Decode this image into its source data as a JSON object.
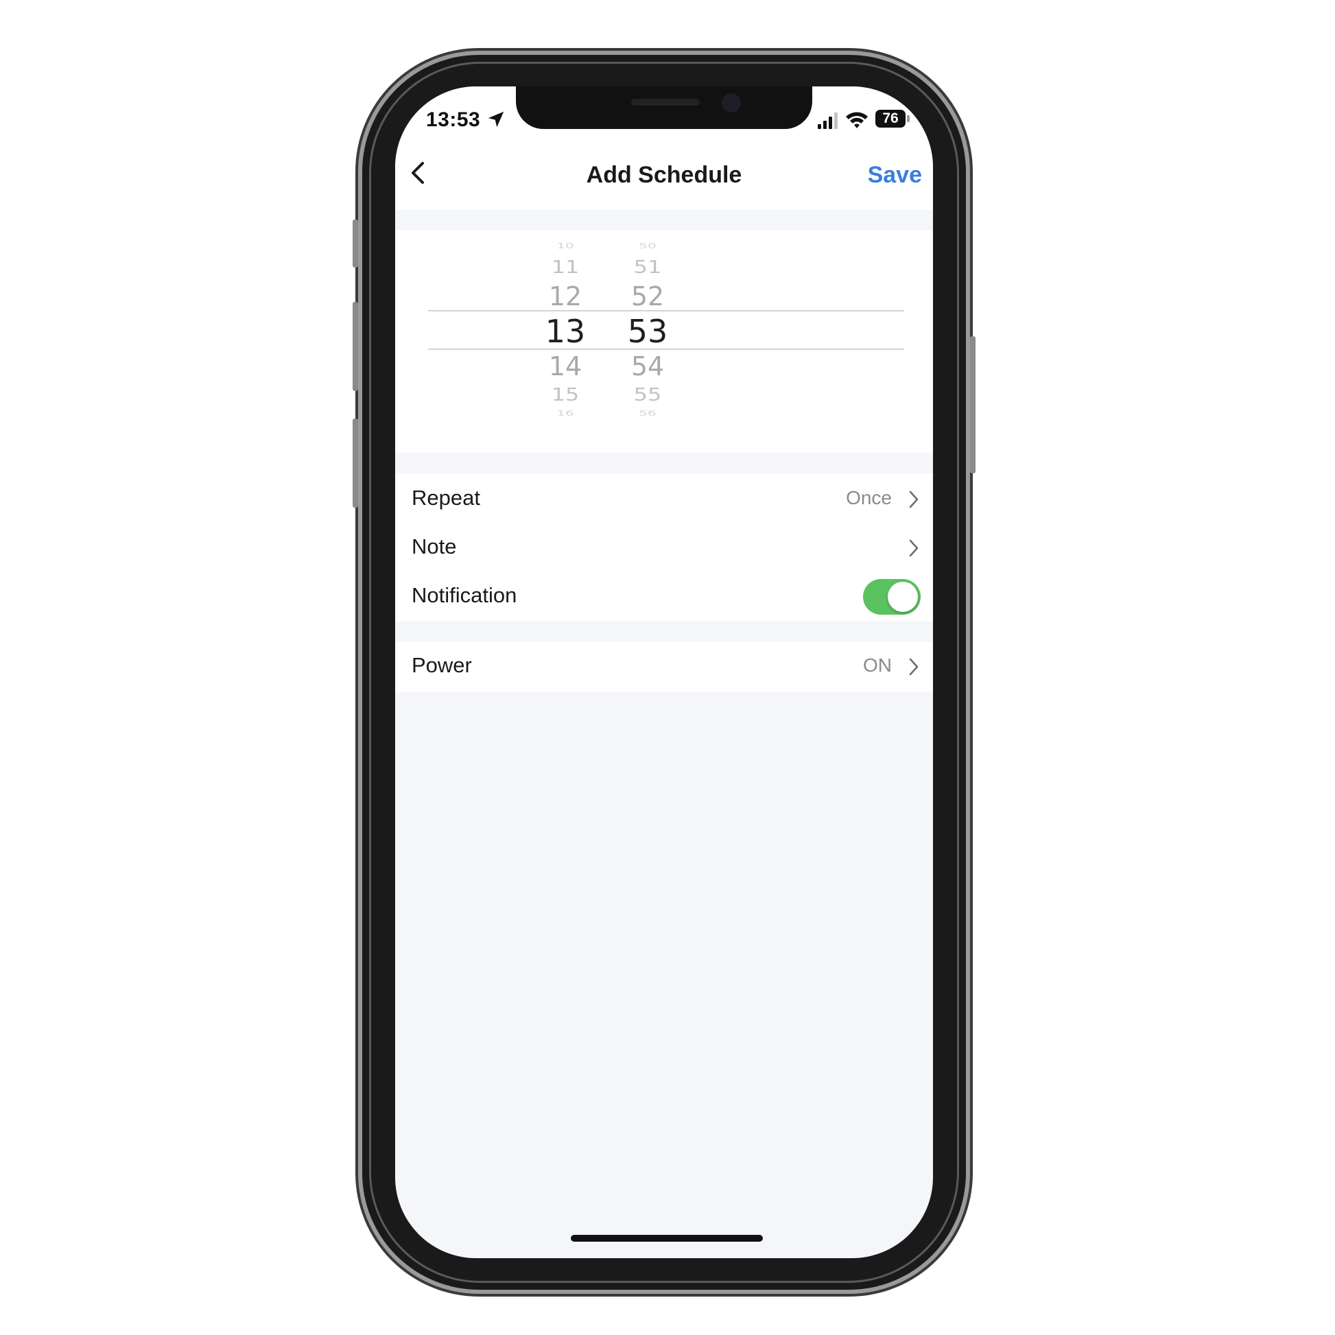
{
  "status_bar": {
    "time": "13:53",
    "battery": "76"
  },
  "nav": {
    "title": "Add Schedule",
    "save_label": "Save"
  },
  "picker": {
    "hours": {
      "above3": "10",
      "above2": "11",
      "above1": "12",
      "selected": "13",
      "below1": "14",
      "below2": "15",
      "below3": "16"
    },
    "minutes": {
      "above3": "50",
      "above2": "51",
      "above1": "52",
      "selected": "53",
      "below1": "54",
      "below2": "55",
      "below3": "56"
    }
  },
  "settings": {
    "repeat": {
      "label": "Repeat",
      "value": "Once"
    },
    "note": {
      "label": "Note"
    },
    "notification": {
      "label": "Notification",
      "enabled": true
    },
    "power": {
      "label": "Power",
      "value": "ON"
    }
  },
  "colors": {
    "accent": "#3a7dde",
    "toggle_on": "#5ac25e",
    "background": "#f5f6f9"
  }
}
